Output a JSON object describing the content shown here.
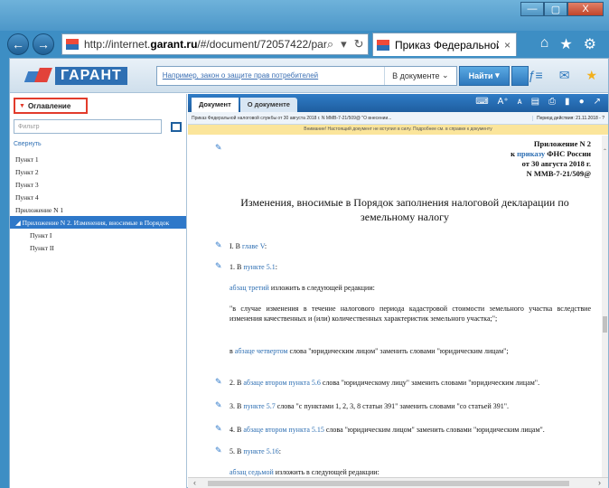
{
  "window": {
    "minimize": "—",
    "maximize": "▢",
    "close": "X"
  },
  "browser": {
    "url_prefix": "http://internet.",
    "url_domain": "garant.ru",
    "url_rest": "/#/document/72057422/par",
    "tab_title": "Приказ Федеральной ...",
    "tab_close": "×"
  },
  "app": {
    "logo": "ГАРАНТ",
    "search_placeholder": "Например, закон о защите прав потребителей",
    "search_scope": "В документе",
    "find_button": "Найти"
  },
  "toc": {
    "header": "Оглавление",
    "filter_placeholder": "Фильтр",
    "collapse": "Свернуть",
    "items": [
      {
        "label": "Пункт 1"
      },
      {
        "label": "Пункт 2"
      },
      {
        "label": "Пункт 3"
      },
      {
        "label": "Пункт 4"
      },
      {
        "label": "Приложение N 1"
      },
      {
        "label": "Приложение N 2. Изменения, вносимые в Порядок"
      },
      {
        "label": "Пункт I"
      },
      {
        "label": "Пункт II"
      }
    ]
  },
  "doc": {
    "tab_active": "Документ",
    "tab_inactive": "О документе",
    "info_title": "Приказ Федеральной налоговой службы от 30 августа 2018 г. N ММВ-7-21/509@ \"О внесении...",
    "info_period": "Период действия: 21.11.2018 - ?",
    "warning": "Внимание! Настоящий документ не вступил в силу. Подробнее см. в справке к документу",
    "appendix": {
      "line1": "Приложение N 2",
      "line2_pre": "к ",
      "line2_link": "приказу",
      "line2_post": " ФНС России",
      "line3": "от 30 августа 2018 г.",
      "line4": "N ММВ-7-21/509@"
    },
    "heading": "Изменения, вносимые в Порядок заполнения налоговой декларации по земельному налогу",
    "p1_pre": "I. В ",
    "p1_link": "главе V",
    "p1_post": ":",
    "p2_pre": "1. В ",
    "p2_link": "пункте 5.1",
    "p2_post": ":",
    "p3_link": "абзац третий",
    "p3_post": " изложить в следующей редакции:",
    "quote1": "\"в случае изменения в течение налогового периода кадастровой стоимости земельного участка вследствие изменения качественных и (или) количественных характеристик земельного участка;\";",
    "p4_pre": "в ",
    "p4_link": "абзаце четвертом",
    "p4_post": " слова \"юридическим лицом\" заменить словами \"юридическим лицам\";",
    "p5_pre": "2. В ",
    "p5_link1": "абзаце втором",
    "p5_link2": "пункта 5.6",
    "p5_post": " слова \"юридическому лицу\" заменить словами \"юридическим лицам\".",
    "p6_pre": "3. В ",
    "p6_link": "пункте 5.7",
    "p6_post": " слова \"с пунктами 1, 2, 3, 8 статьи 391\" заменить словами \"со статьей 391\".",
    "p7_pre": "4. В ",
    "p7_link": "абзаце втором пункта 5.15",
    "p7_post": " слова \"юридическим лицом\" заменить словами \"юридическим лицам\".",
    "p8_pre": "5. В ",
    "p8_link": "пункте 5.16",
    "p8_post": ":",
    "p9_link": "абзац седьмой",
    "p9_post": " изложить в следующей редакции:"
  }
}
